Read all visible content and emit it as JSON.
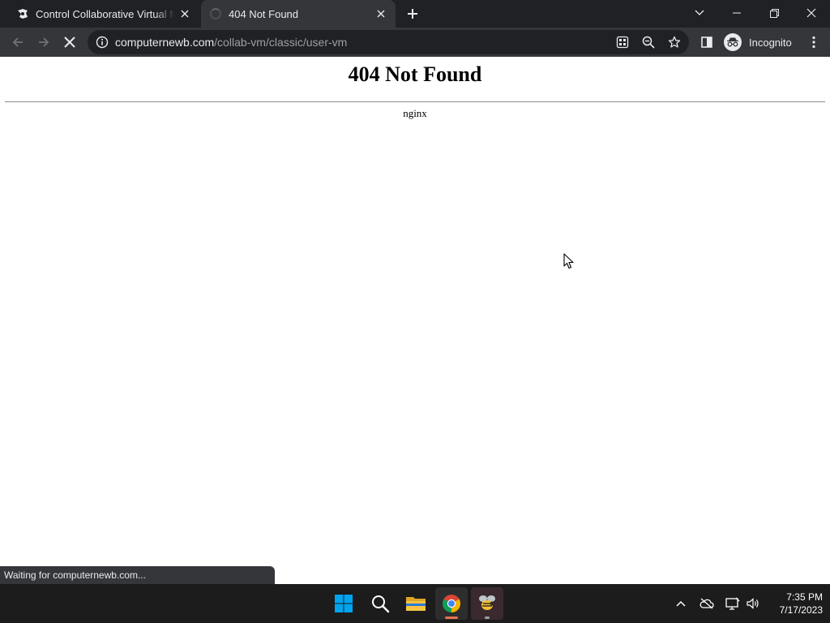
{
  "browser": {
    "tabs": [
      {
        "title": "Control Collaborative Virtual Mac",
        "active": false,
        "favicon": "collabvm-icon"
      },
      {
        "title": "404 Not Found",
        "active": true,
        "favicon": "loading-spinner-icon"
      }
    ],
    "address_bar": {
      "host": "computernewb.com",
      "path": "/collab-vm/classic/user-vm"
    },
    "profile_label": "Incognito",
    "status_text": "Waiting for computernewb.com..."
  },
  "page": {
    "heading": "404 Not Found",
    "server": "nginx"
  },
  "taskbar": {
    "apps": [
      "start-icon",
      "search-icon",
      "file-explorer-icon",
      "chrome-icon",
      "collabvm-app-icon"
    ],
    "clock": {
      "time": "7:35 PM",
      "date": "7/17/2023"
    }
  },
  "colors": {
    "titlebar": "#202124",
    "toolbar": "#35363a",
    "accent_windows": "#00a4ef",
    "chrome_indicator": "#e8734f"
  }
}
